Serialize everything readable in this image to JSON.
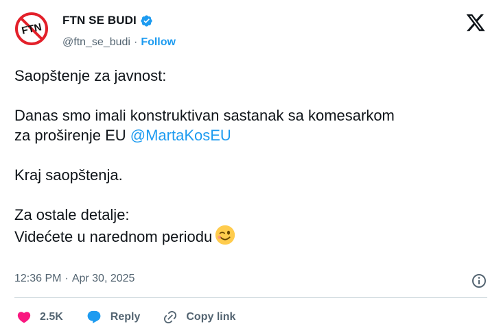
{
  "author": {
    "name": "FTN SE BUDI",
    "handle": "@ftn_se_budi",
    "separator": "·",
    "follow_label": "Follow",
    "avatar_text": "FTN"
  },
  "tweet": {
    "line1": "Saopštenje za javnost:",
    "line2": "Danas smo imali konstruktivan sastanak sa komesarkom",
    "line3_prefix": "za proširenje EU ",
    "mention": "@MartaKosEU",
    "line4": "Kraj saopštenja.",
    "line5": "Za ostale detalje:",
    "line6": "Videćete u narednom periodu"
  },
  "meta": {
    "time": "12:36 PM",
    "separator": "·",
    "date": "Apr 30, 2025"
  },
  "actions": {
    "likes": "2.5K",
    "reply_label": "Reply",
    "copy_label": "Copy link"
  },
  "colors": {
    "accent": "#1d9bf0",
    "like": "#f91880",
    "muted": "#536471",
    "divider": "#cfd9de"
  },
  "icons": [
    "verified-badge-icon",
    "x-logo-icon",
    "wink-emoji-icon",
    "info-icon",
    "heart-icon",
    "reply-bubble-icon",
    "link-icon"
  ]
}
